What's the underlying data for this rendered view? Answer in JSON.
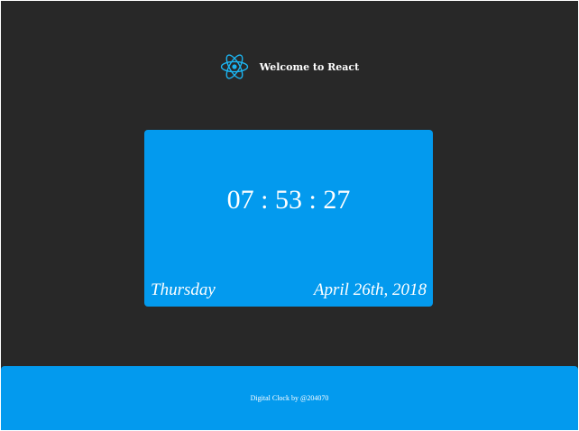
{
  "header": {
    "logo_icon": "react-atom-icon",
    "title": "Welcome to React"
  },
  "clock": {
    "time": "07 : 53 : 27",
    "day": "Thursday",
    "date": "April 26th, 2018"
  },
  "footer": {
    "credit": "Digital Clock by @204070"
  },
  "colors": {
    "background": "#282828",
    "accent": "#039aee",
    "logo": "#1cb4f0",
    "text": "#ffffff"
  }
}
